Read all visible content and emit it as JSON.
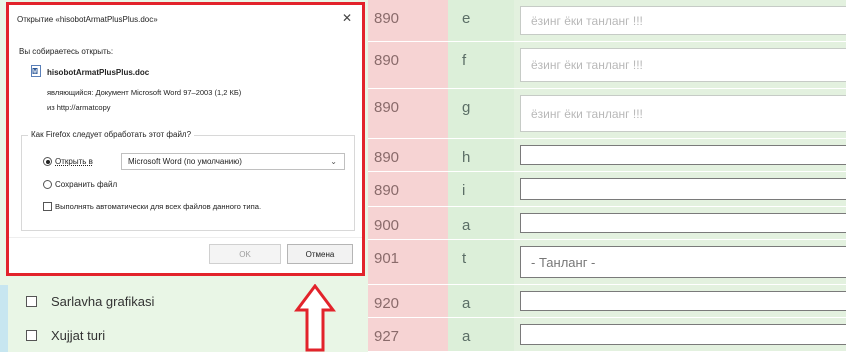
{
  "rows": [
    {
      "tag": "890",
      "code": "e",
      "input": "ёзинг ёки танланг !!!",
      "kind": "hint"
    },
    {
      "tag": "890",
      "code": "f",
      "input": "ёзинг ёки танланг !!!",
      "kind": "hint"
    },
    {
      "tag": "890",
      "code": "g",
      "input": "ёзинг ёки танланг !!!",
      "kind": "hint"
    },
    {
      "tag": "890",
      "code": "h",
      "input": "",
      "kind": "plain"
    },
    {
      "tag": "890",
      "code": "i",
      "input": "",
      "kind": "plain"
    },
    {
      "tag": "900",
      "code": "a",
      "input": "",
      "kind": "plain"
    },
    {
      "tag": "901",
      "code": "t",
      "input": "- Танланг -",
      "kind": "select"
    },
    {
      "tag": "920",
      "code": "a",
      "input": "",
      "kind": "plain",
      "label": "Sarlavha grafikasi"
    },
    {
      "tag": "927",
      "code": "a",
      "input": "",
      "kind": "plain",
      "label": "Xujjat turi"
    }
  ],
  "dialog": {
    "title": "Открытие «hisobotArmatPlusPlus.doc»",
    "close": "✕",
    "open_text": "Вы собираетесь открыть:",
    "file_name": "hisobotArmatPlusPlus.doc",
    "file_type": "являющийся: Документ Microsoft Word 97–2003 (1,2 КБ)",
    "file_from": "из http://armatcopy",
    "question": "Как Firefox следует обработать этот файл?",
    "open_with_label": "Открыть в",
    "open_with_app": "Microsoft Word (по умолчанию)",
    "save_label": "Сохранить файл",
    "auto_label": "Выполнять автоматически для всех файлов данного типа.",
    "ok_label": "OK",
    "cancel_label": "Отмена"
  },
  "colors": {
    "highlight_border": "#e2232b",
    "tag_bg": "#f6d3d3",
    "code_bg": "#dcefd9",
    "row_bg": "#e9f6e6"
  },
  "icons": [
    "word-document-icon",
    "up-arrow-annotation-icon",
    "chevron-down-icon",
    "close-icon"
  ]
}
